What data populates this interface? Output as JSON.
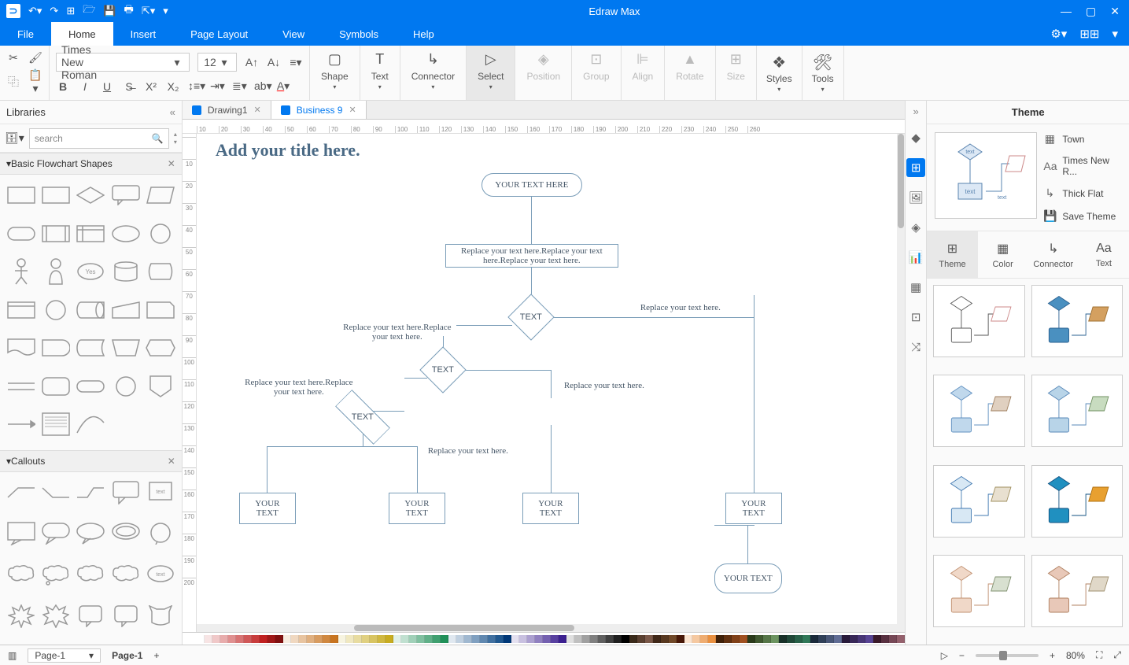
{
  "app_title": "Edraw Max",
  "menu": {
    "items": [
      "File",
      "Home",
      "Insert",
      "Page Layout",
      "View",
      "Symbols",
      "Help"
    ],
    "active": "Home"
  },
  "ribbon": {
    "font_name": "Times New Roman",
    "font_size": "12",
    "tools": {
      "shape": "Shape",
      "text": "Text",
      "connector": "Connector",
      "select": "Select"
    },
    "arrange": {
      "position": "Position",
      "group": "Group",
      "align": "Align",
      "rotate": "Rotate",
      "size": "Size"
    },
    "styles": "Styles",
    "tools_group": "Tools"
  },
  "left": {
    "title": "Libraries",
    "search_placeholder": "search",
    "sections": {
      "flowchart": "Basic Flowchart Shapes",
      "callouts": "Callouts"
    }
  },
  "docs": {
    "tab1": "Drawing1",
    "tab2": "Business 9"
  },
  "canvas": {
    "title": "Add your title here.",
    "terminator1": "YOUR TEXT HERE",
    "process1": "Replace your text here.Replace your text here.Replace your text here.",
    "decision1": "TEXT",
    "decision2": "TEXT",
    "decision3": "TEXT",
    "label1": "Replace your text here.",
    "label2": "Replace your text here.Replace your text here.",
    "label3": "Replace your text here.",
    "label4": "Replace your text here.Replace your text here.",
    "label5": "Replace your text here.",
    "box1": "YOUR TEXT",
    "box2": "YOUR TEXT",
    "box3": "YOUR TEXT",
    "box4": "YOUR TEXT",
    "terminator2": "YOUR TEXT"
  },
  "right": {
    "title": "Theme",
    "prop_town": "Town",
    "prop_font": "Times New R...",
    "prop_line": "Thick Flat",
    "prop_save": "Save Theme",
    "tabs": {
      "theme": "Theme",
      "color": "Color",
      "connector": "Connector",
      "text": "Text"
    }
  },
  "status": {
    "page_select": "Page-1",
    "page_label": "Page-1",
    "zoom": "80%"
  },
  "ruler_h": [
    "10",
    "20",
    "30",
    "40",
    "50",
    "60",
    "70",
    "80",
    "90",
    "100",
    "110",
    "120",
    "130",
    "140",
    "150",
    "160",
    "170",
    "180",
    "190",
    "200",
    "210",
    "220",
    "230",
    "240",
    "250",
    "260"
  ],
  "ruler_v": [
    "",
    "10",
    "20",
    "30",
    "40",
    "50",
    "60",
    "70",
    "80",
    "90",
    "100",
    "110",
    "120",
    "130",
    "140",
    "150",
    "160",
    "170",
    "180",
    "190",
    "200"
  ],
  "colors": [
    "#fff",
    "#f7e4e4",
    "#f0c8c8",
    "#e8acac",
    "#e09090",
    "#d87474",
    "#d05858",
    "#c83c3c",
    "#c02020",
    "#a01818",
    "#801010",
    "#f7ece0",
    "#f0d8c0",
    "#e8c4a0",
    "#e0b080",
    "#d89c60",
    "#d08840",
    "#c87420",
    "#f7f4e0",
    "#f0e8c0",
    "#e8dca0",
    "#e0d080",
    "#d8c460",
    "#d0b840",
    "#c8ac20",
    "#e0f0e8",
    "#c0e0d0",
    "#a0d0b8",
    "#80c0a0",
    "#60b088",
    "#40a070",
    "#209058",
    "#e0e8f0",
    "#c0d0e0",
    "#a0b8d0",
    "#80a0c0",
    "#6088b0",
    "#4070a0",
    "#205890",
    "#003878",
    "#e4e0f0",
    "#c8c0e0",
    "#aca0d0",
    "#9080c0",
    "#7460b0",
    "#5840a0",
    "#3c2090",
    "#e0e0e0",
    "#c0c0c0",
    "#a0a0a0",
    "#808080",
    "#606060",
    "#404040",
    "#202020",
    "#000",
    "#3a2a1a",
    "#5a4030",
    "#7a5848",
    "#402818",
    "#583820",
    "#704828",
    "#481808",
    "#fbe4d0",
    "#f5c8a0",
    "#efac70",
    "#e99040",
    "#402008",
    "#603010",
    "#804018",
    "#a05020",
    "#2a3a1a",
    "#405830",
    "#567648",
    "#6c9460",
    "#183028",
    "#204838",
    "#286048",
    "#307858",
    "#1a2a3a",
    "#304058",
    "#485676",
    "#606c94",
    "#281a3a",
    "#382858",
    "#483676",
    "#584494",
    "#3a1a2a",
    "#583040",
    "#764856",
    "#94606c"
  ]
}
